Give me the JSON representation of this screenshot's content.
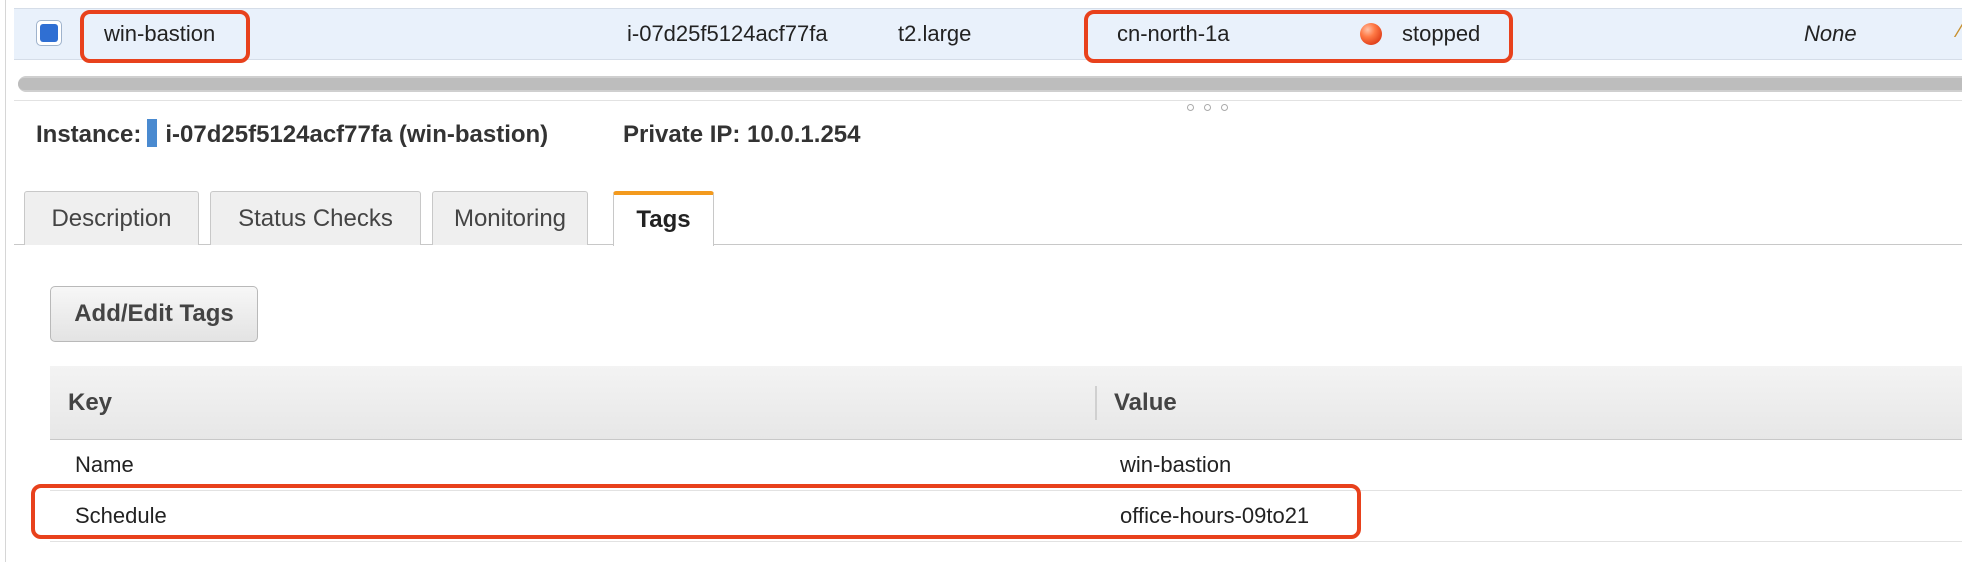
{
  "instance_row": {
    "name": "win-bastion",
    "instance_id": "i-07d25f5124acf77fa",
    "instance_type": "t2.large",
    "availability_zone": "cn-north-1a",
    "state": "stopped",
    "state_color": "#e1411b",
    "last_column": "None"
  },
  "details": {
    "instance_label": "Instance:",
    "instance_value": "i-07d25f5124acf77fa (win-bastion)",
    "private_ip": "Private IP: 10.0.1.254"
  },
  "tabs": [
    {
      "label": "Description",
      "active": false
    },
    {
      "label": "Status Checks",
      "active": false
    },
    {
      "label": "Monitoring",
      "active": false
    },
    {
      "label": "Tags",
      "active": true
    }
  ],
  "tags_panel": {
    "add_edit_label": "Add/Edit Tags",
    "columns": [
      "Key",
      "Value"
    ],
    "rows": [
      {
        "key": "Name",
        "value": "win-bastion"
      },
      {
        "key": "Schedule",
        "value": "office-hours-09to21"
      }
    ]
  },
  "colors": {
    "highlight": "#e8411c",
    "active_tab_accent": "#f39a1e",
    "selected_row_bg": "#e9f1fb"
  }
}
